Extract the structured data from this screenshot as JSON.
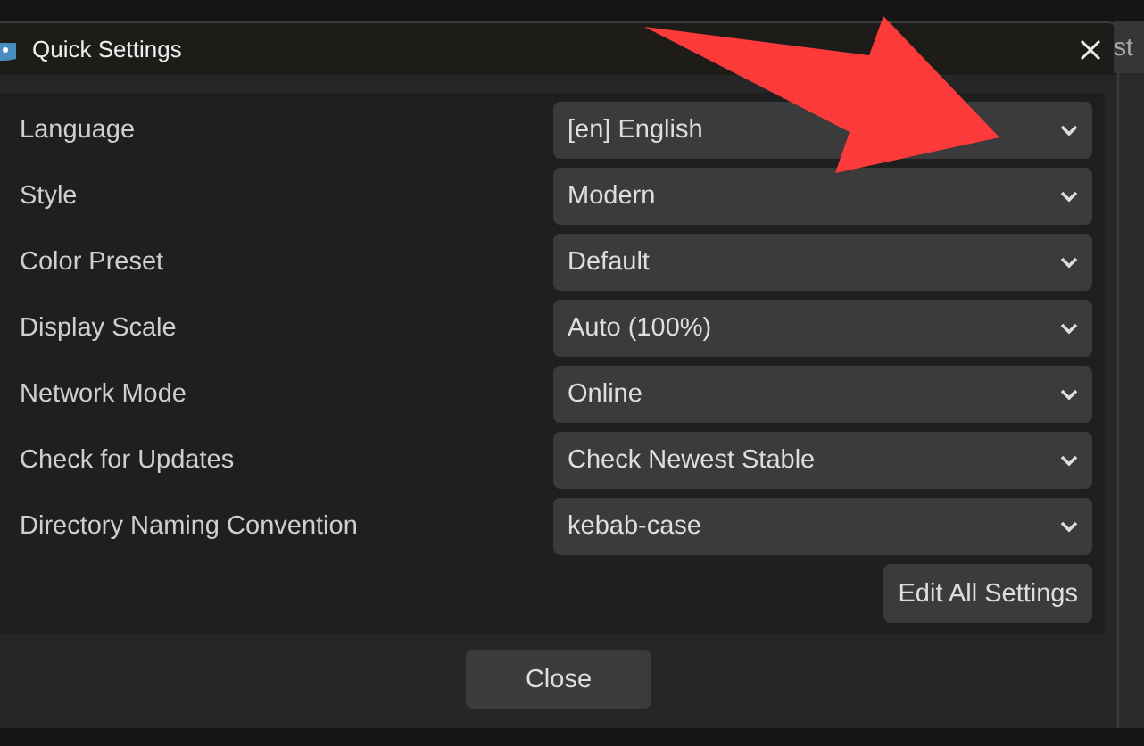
{
  "window": {
    "title": "Quick Settings"
  },
  "settings": [
    {
      "label": "Language",
      "value": "[en] English"
    },
    {
      "label": "Style",
      "value": "Modern"
    },
    {
      "label": "Color Preset",
      "value": "Default"
    },
    {
      "label": "Display Scale",
      "value": "Auto (100%)"
    },
    {
      "label": "Network Mode",
      "value": "Online"
    },
    {
      "label": "Check for Updates",
      "value": "Check Newest Stable"
    },
    {
      "label": "Directory Naming Convention",
      "value": "kebab-case"
    }
  ],
  "edit_button": "Edit All Settings",
  "close_button": "Close",
  "background_window": {
    "text": "st"
  },
  "annotation": {
    "kind": "arrow"
  }
}
